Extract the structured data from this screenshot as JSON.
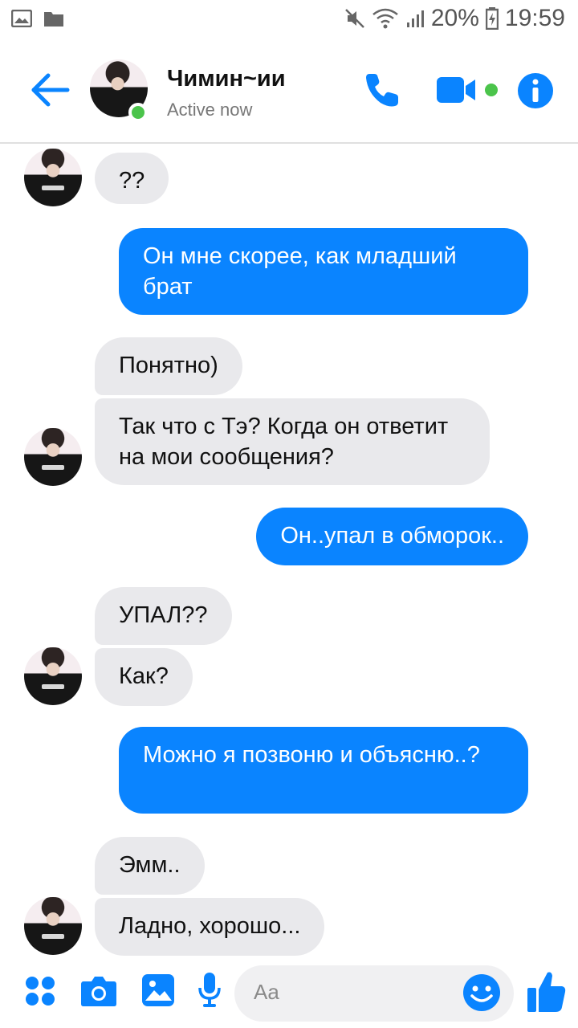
{
  "statusbar": {
    "battery": "20%",
    "time": "19:59"
  },
  "header": {
    "contact_name": "Чимин~ии",
    "status": "Active now"
  },
  "messages": [
    {
      "side": "in",
      "text": "??"
    },
    {
      "side": "out",
      "text": "Он мне скорее, как младший брат"
    },
    {
      "side": "in",
      "text": "Понятно)"
    },
    {
      "side": "in",
      "text": "Так что с Тэ? Когда он ответит на мои сообщения?"
    },
    {
      "side": "out",
      "text": "Он..упал в обморок.."
    },
    {
      "side": "in",
      "text": "УПАЛ??"
    },
    {
      "side": "in",
      "text": "Как?"
    },
    {
      "side": "out",
      "text": "Можно я позвоню и объясню..?"
    },
    {
      "side": "in",
      "text": "Эмм.."
    },
    {
      "side": "in",
      "text": "Ладно, хорошо..."
    }
  ],
  "composer": {
    "placeholder": "Aa"
  },
  "colors": {
    "accent": "#0a84ff",
    "incoming_bubble": "#e9e9ec",
    "online": "#4bc44b"
  }
}
